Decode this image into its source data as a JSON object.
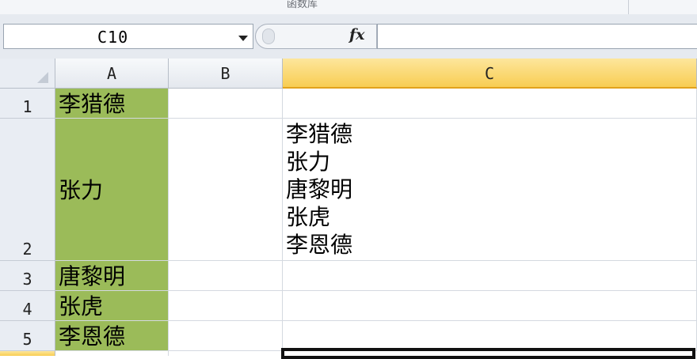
{
  "ribbon": {
    "group_label": "函数库"
  },
  "formula_bar": {
    "name_box": "C10",
    "fx_label": "fx",
    "formula": ""
  },
  "columns": [
    "A",
    "B",
    "C"
  ],
  "selected_column": "C",
  "rows": [
    "1",
    "2",
    "3",
    "4",
    "5"
  ],
  "cells": {
    "A1": "李猎德",
    "A2": "张力",
    "A3": "唐黎明",
    "A4": "张虎",
    "A5": "李恩德",
    "C2": [
      "李猎德",
      "张力",
      "唐黎明",
      "张虎",
      "李恩德"
    ]
  },
  "colors": {
    "highlight_fill": "#9bbb59",
    "selected_header": "#f8cd52"
  }
}
